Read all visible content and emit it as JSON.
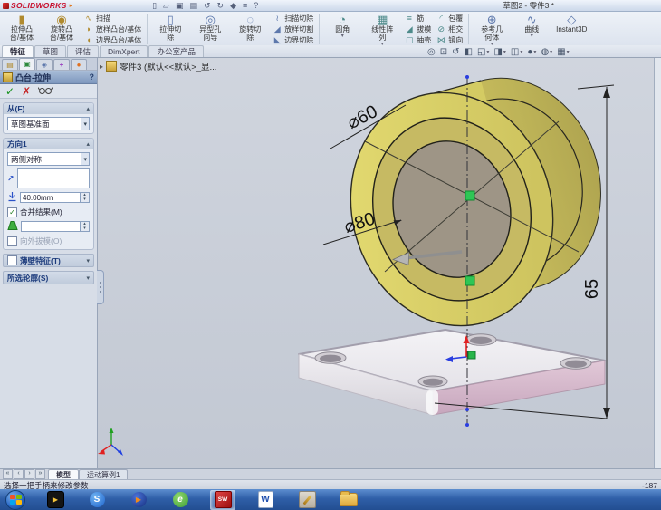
{
  "titlebar": {
    "brand": "SOLIDWORKS",
    "menu_arrow": "▸",
    "title": "草图2 - 零件3 *",
    "quickbar": [
      {
        "glyph": "▯"
      },
      {
        "glyph": "▱"
      },
      {
        "glyph": "▣"
      },
      {
        "glyph": "▤"
      },
      {
        "glyph": "↺"
      },
      {
        "glyph": "↻"
      },
      {
        "glyph": "◆"
      },
      {
        "glyph": "≡"
      },
      {
        "glyph": "?"
      }
    ]
  },
  "ribbon": {
    "cols": [
      {
        "glyph": "▮",
        "line1": "拉伸凸",
        "line2": "台/基体"
      },
      {
        "glyph": "◉",
        "line1": "旋转凸",
        "line2": "台/基体"
      },
      {
        "items": [
          {
            "glyph": "∿",
            "label": "扫描"
          },
          {
            "glyph": "◗",
            "label": "放样凸台/基体"
          },
          {
            "glyph": "◖",
            "label": "边界凸台/基体"
          }
        ]
      },
      {
        "type": "sep"
      },
      {
        "glyph": "▯",
        "line1": "拉伸切",
        "line2": "除"
      },
      {
        "glyph": "◎",
        "line1": "异型孔",
        "line2": "向导"
      },
      {
        "glyph": "◌",
        "line1": "旋转切",
        "line2": "除"
      },
      {
        "items": [
          {
            "glyph": "≀",
            "label": "扫描切除"
          },
          {
            "glyph": "◢",
            "label": "放样切割"
          },
          {
            "glyph": "◣",
            "label": "边界切除"
          }
        ]
      },
      {
        "type": "sep"
      },
      {
        "glyph": "◔",
        "line1": "圆角",
        "line2": "",
        "caret": "▾"
      },
      {
        "glyph": "▦",
        "line1": "线性阵",
        "line2": "列",
        "caret": "▾"
      },
      {
        "items": [
          {
            "glyph": "≡",
            "label": "筋"
          },
          {
            "glyph": "◢",
            "label": "拔模"
          },
          {
            "glyph": "▢",
            "label": "抽壳"
          }
        ]
      },
      {
        "items": [
          {
            "glyph": "◜",
            "label": "包覆"
          },
          {
            "glyph": "⊘",
            "label": "相交"
          },
          {
            "glyph": "⋈",
            "label": "镜向"
          }
        ]
      },
      {
        "type": "sep"
      },
      {
        "glyph": "⊕",
        "line1": "参考几",
        "line2": "何体",
        "caret": "▾"
      },
      {
        "glyph": "∿",
        "line1": "曲线",
        "line2": "",
        "caret": "▾"
      },
      {
        "glyph": "◇",
        "line1": "Instant3D",
        "line2": ""
      }
    ]
  },
  "command_tabs": [
    {
      "label": "特征"
    },
    {
      "label": "草图"
    },
    {
      "label": "评估"
    },
    {
      "label": "DimXpert"
    },
    {
      "label": "办公室产品"
    }
  ],
  "viewbar": [
    {
      "glyph": "◎"
    },
    {
      "glyph": "⊡"
    },
    {
      "glyph": "↺"
    },
    {
      "glyph": "◧"
    },
    {
      "glyph": "◱",
      "caret": "▾"
    },
    {
      "glyph": "◨",
      "caret": "▾"
    },
    {
      "glyph": "◫",
      "caret": "▾"
    },
    {
      "glyph": "●",
      "caret": "▾"
    },
    {
      "glyph": "◍",
      "caret": "▾"
    },
    {
      "glyph": "▦",
      "caret": "▾"
    }
  ],
  "pm": {
    "tabs": [
      {
        "glyph": "▤"
      },
      {
        "glyph": "▣"
      },
      {
        "glyph": "◈"
      },
      {
        "glyph": "+"
      },
      {
        "glyph": "●"
      }
    ],
    "title": "凸台-拉伸",
    "help": "?",
    "ok_glyph": "✓",
    "cancel_glyph": "✗",
    "from_header": "从(F)",
    "from_value": "草图基准面",
    "dir_header": "方向1",
    "dir_value": "两侧对称",
    "reverse_glyph": "↗",
    "depth_value": "40.00mm",
    "merge_check": "✓",
    "merge_label": "合并结果(M)",
    "draft_out_label": "向外拔模(O)",
    "thin_label": "薄壁特征(T)",
    "contours_label": "所选轮廓(S)",
    "collapse_glyph": "▴",
    "expand_glyph": "▾",
    "spin_up": "▴",
    "spin_down": "▾",
    "dd_glyph": "▾"
  },
  "tree": {
    "expand": "▸",
    "root": "零件3 (默认<<默认>_显..."
  },
  "model": {
    "d60": "⌀60",
    "d80": "⌀80",
    "h65": "65"
  },
  "bottom": {
    "nav": [
      "«",
      "‹",
      "›",
      "»"
    ],
    "tabs": [
      {
        "label": "模型"
      },
      {
        "label": "运动算例1"
      }
    ],
    "status": "选择一把手柄来修改参数",
    "coord": "-187"
  },
  "taskbar": {
    "apps": [
      {
        "letter": "▶"
      },
      {
        "letter": "S"
      },
      {
        "letter": "▶"
      },
      {
        "letter": "e"
      },
      {
        "letter": "SW"
      },
      {
        "letter": "W"
      }
    ]
  },
  "colors": {
    "preview_yellow": "#dcd468",
    "plate_pink": "#d9bdd0",
    "handle_green": "#28b54a",
    "taskbar_blue": "#2f5fa8"
  }
}
